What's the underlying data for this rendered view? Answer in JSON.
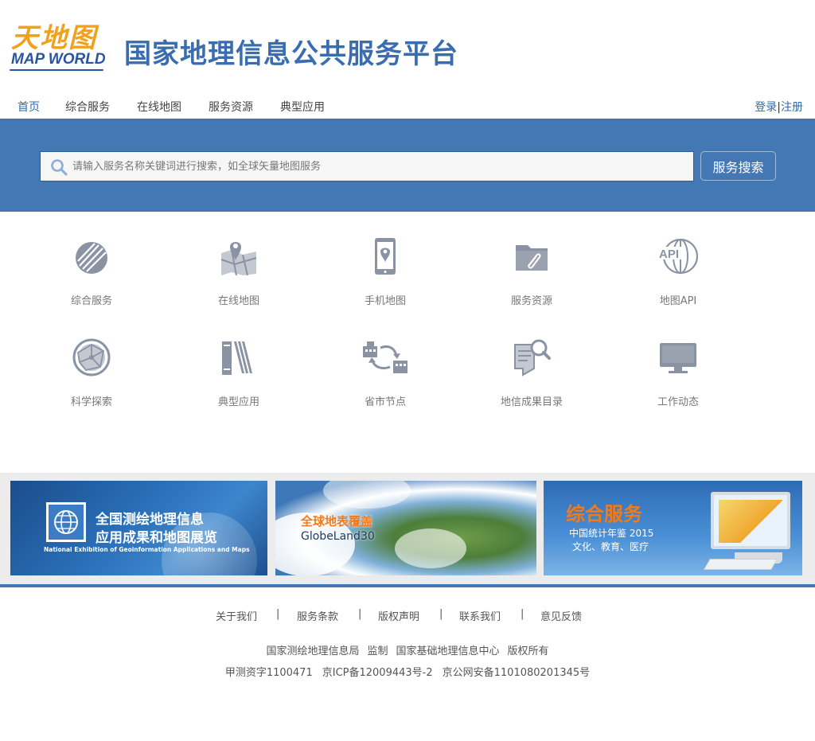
{
  "header": {
    "logo_cn": "天地图",
    "logo_en": "MAP WORLD",
    "site_title": "国家地理信息公共服务平台"
  },
  "nav": {
    "items": [
      {
        "label": "首页",
        "active": true
      },
      {
        "label": "综合服务"
      },
      {
        "label": "在线地图"
      },
      {
        "label": "服务资源"
      },
      {
        "label": "典型应用"
      }
    ],
    "login": "登录",
    "separator": "|",
    "register": "注册"
  },
  "search": {
    "placeholder": "请输入服务名称关键词进行搜索，如全球矢量地图服务",
    "button_label": "服务搜索"
  },
  "services": [
    {
      "label": "综合服务",
      "icon": "globe-slash-icon"
    },
    {
      "label": "在线地图",
      "icon": "map-pin-icon"
    },
    {
      "label": "手机地图",
      "icon": "mobile-map-icon"
    },
    {
      "label": "服务资源",
      "icon": "folder-clip-icon"
    },
    {
      "label": "地图API",
      "icon": "api-globe-icon"
    },
    {
      "label": "科学探索",
      "icon": "network-globe-icon"
    },
    {
      "label": "典型应用",
      "icon": "books-icon"
    },
    {
      "label": "省市节点",
      "icon": "buildings-exchange-icon"
    },
    {
      "label": "地信成果目录",
      "icon": "document-search-icon"
    },
    {
      "label": "工作动态",
      "icon": "monitor-icon"
    }
  ],
  "banners": [
    {
      "title_line1": "全国测绘地理信息",
      "title_line2": "应用成果和地图展览",
      "subtitle": "National Exhibition of Geoinformation Applications and Maps"
    },
    {
      "title": "全球地表覆盖",
      "subtitle": "GlobeLand30"
    },
    {
      "title": "综合服务",
      "line1": "中国统计年鉴 2015",
      "line2": "文化、教育、医疗"
    }
  ],
  "footer": {
    "links": [
      "关于我们",
      "服务条款",
      "版权声明",
      "联系我们",
      "意见反馈"
    ],
    "separator": "|",
    "copyright_line1": [
      "国家测绘地理信息局",
      "监制",
      "国家基础地理信息中心",
      "版权所有"
    ],
    "copyright_line2": [
      "甲测资字1100471",
      "京ICP备12009443号-2",
      "京公网安备1101080201345号"
    ]
  },
  "colors": {
    "brand_blue": "#4378b5",
    "title_blue": "#3a6db0",
    "logo_orange": "#f0a11e",
    "icon_gray": "#8a93a3",
    "banner_accent_orange": "#f27a1a"
  }
}
